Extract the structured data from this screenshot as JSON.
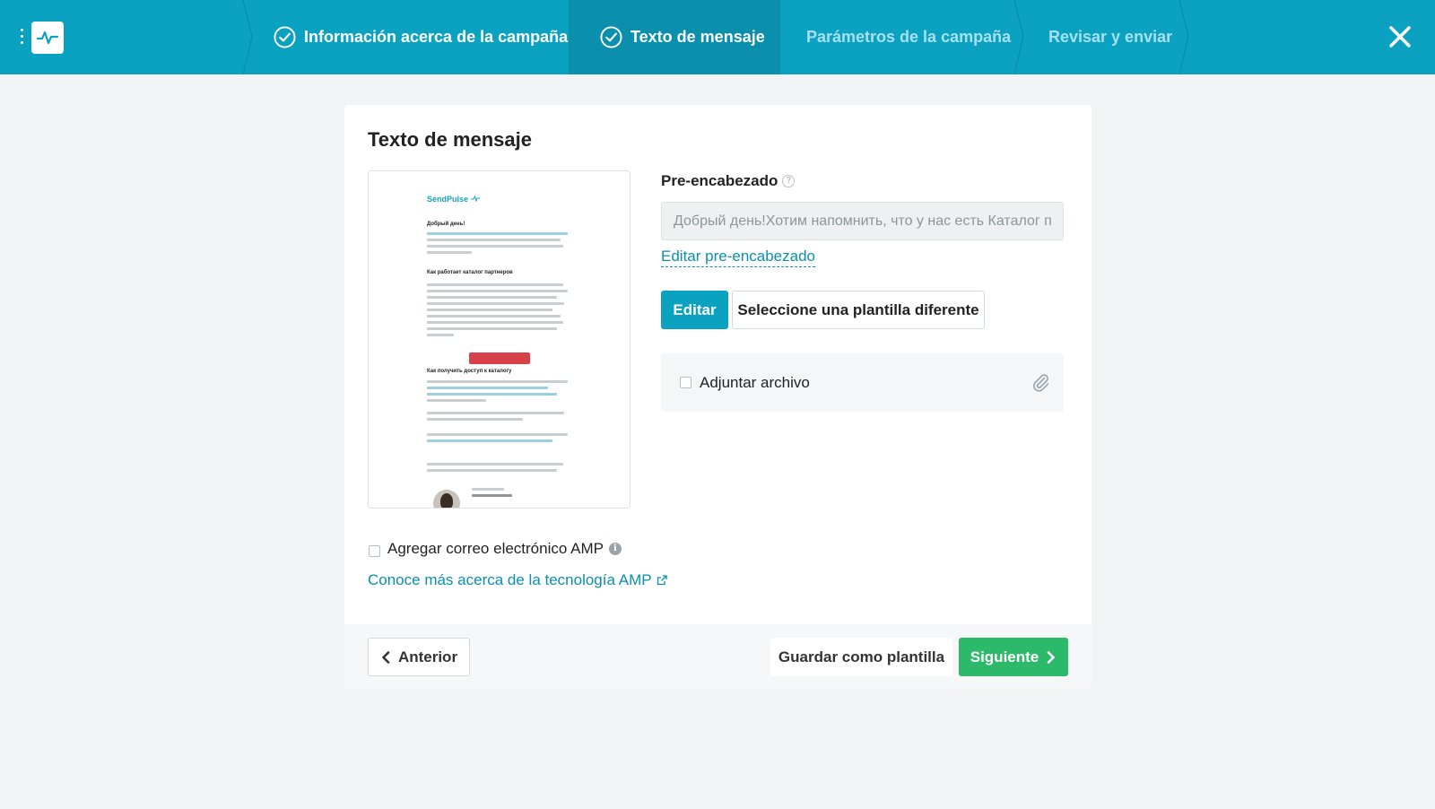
{
  "header": {
    "steps": [
      {
        "label": "Información acerca de la campaña",
        "state": "done"
      },
      {
        "label": "Texto de mensaje",
        "state": "active"
      },
      {
        "label": "Parámetros de la campaña",
        "state": "pending"
      },
      {
        "label": "Revisar y enviar",
        "state": "pending"
      }
    ],
    "menu_icon": "vertical-dots-icon",
    "logo_icon": "pulse-logo-icon",
    "close_icon": "close-icon"
  },
  "main": {
    "title": "Texto de mensaje",
    "preview": {
      "brand": "SendPulse",
      "heading_1": "Добрый день!",
      "heading_2": "Как работает каталог партнеров",
      "heading_3": "Как получить доступ к каталогу"
    },
    "preheader": {
      "label": "Pre-encabezado",
      "value": "Добрый день!Хотим напомнить, что у нас есть Каталог партнеров",
      "edit_link": "Editar pre-encabezado"
    },
    "edit_button": "Editar",
    "template_button": "Seleccione una plantilla diferente",
    "attach": {
      "label": "Adjuntar archivo",
      "checked": false,
      "icon": "paperclip-icon"
    },
    "amp": {
      "label": "Agregar correo electrónico AMP",
      "checked": false,
      "link": "Conoce más acerca de la tecnología AMP"
    }
  },
  "footer": {
    "prev": "Anterior",
    "save_template": "Guardar como plantilla",
    "next": "Siguiente"
  },
  "colors": {
    "header_bg": "#0ba2c2",
    "active_step_bg": "#0a90ad",
    "primary": "#0ba2c2",
    "success": "#2db96a"
  }
}
